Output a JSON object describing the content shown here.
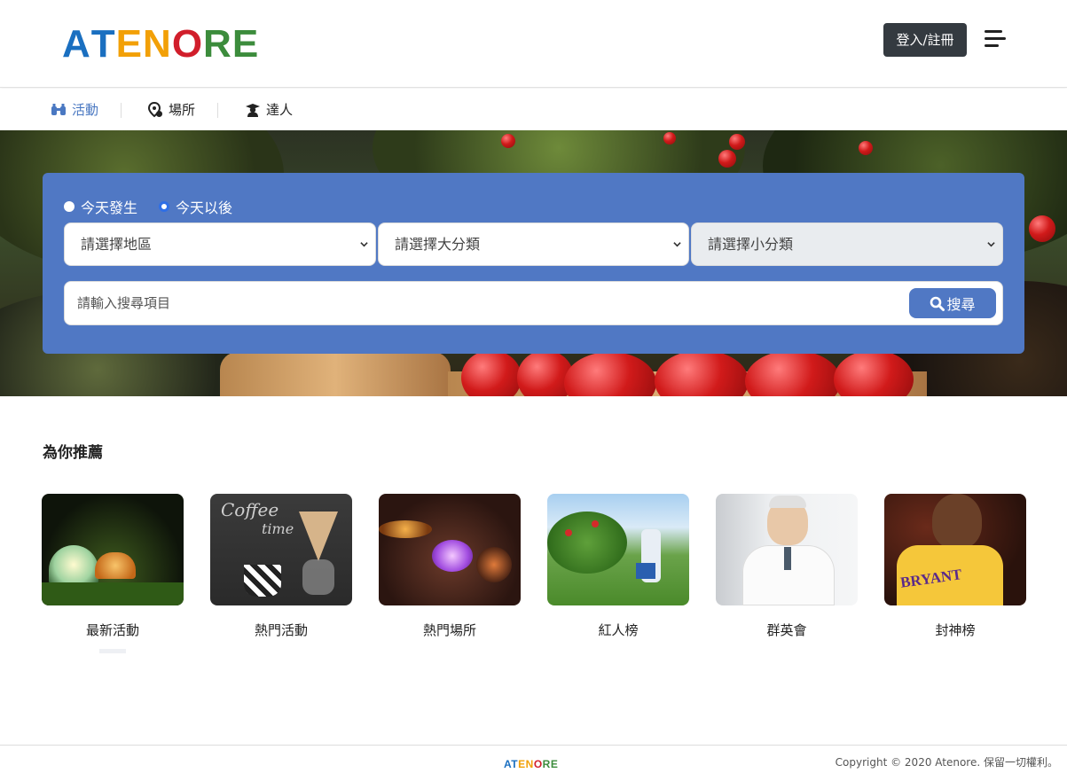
{
  "brand": {
    "letters": [
      {
        "ch": "A",
        "color": "#1a6fc0"
      },
      {
        "ch": "T",
        "color": "#1a6fc0"
      },
      {
        "ch": "E",
        "color": "#f2a007"
      },
      {
        "ch": "N",
        "color": "#f2a007"
      },
      {
        "ch": "O",
        "color": "#d11e2b"
      },
      {
        "ch": "R",
        "color": "#3c8c3c"
      },
      {
        "ch": "E",
        "color": "#3c8c3c"
      }
    ]
  },
  "header": {
    "login_label": "登入/註冊"
  },
  "tabs": [
    {
      "label": "活動",
      "icon": "binoculars-icon",
      "active": true
    },
    {
      "label": "場所",
      "icon": "location-pin-icon",
      "active": false
    },
    {
      "label": "達人",
      "icon": "graduate-icon",
      "active": false
    }
  ],
  "search": {
    "radios": [
      {
        "label": "今天發生",
        "selected": false
      },
      {
        "label": "今天以後",
        "selected": true
      }
    ],
    "region_select": "請選擇地區",
    "major_category_select": "請選擇大分類",
    "minor_category_select": "請選擇小分類",
    "input_placeholder": "請輸入搜尋項目",
    "button_label": "搜尋"
  },
  "recommend": {
    "title": "為你推薦",
    "cards": [
      {
        "label": "最新活動"
      },
      {
        "label": "熱門活動"
      },
      {
        "label": "熱門場所"
      },
      {
        "label": "紅人榜"
      },
      {
        "label": "群英會"
      },
      {
        "label": "封神榜"
      }
    ]
  },
  "footer": {
    "copyright": "Copyright © 2020 Atenore. 保留一切權利。"
  },
  "colors": {
    "accent": "#5078c4",
    "dark_button": "#343a40",
    "active_tab": "#4a78c2"
  }
}
